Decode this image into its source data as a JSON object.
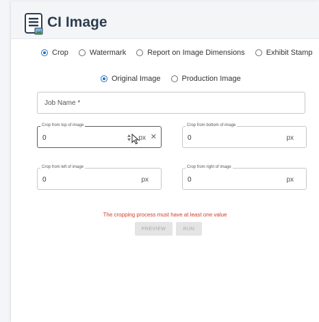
{
  "header": {
    "title": "CI Image",
    "logo_icon": "document-image-icon"
  },
  "mode_options": [
    {
      "label": "Crop",
      "checked": true
    },
    {
      "label": "Watermark",
      "checked": false
    },
    {
      "label": "Report on Image Dimensions",
      "checked": false
    },
    {
      "label": "Exhibit Stamp",
      "checked": false
    }
  ],
  "source_options": [
    {
      "label": "Original Image",
      "checked": true
    },
    {
      "label": "Production Image",
      "checked": false
    }
  ],
  "job_name": {
    "placeholder": "Job Name *",
    "value": ""
  },
  "crop_fields": {
    "top": {
      "label": "Crop from top of image",
      "value": "0",
      "unit": "px",
      "clear": "✕"
    },
    "bottom": {
      "label": "Crop from bottom of image",
      "value": "0",
      "unit": "px"
    },
    "left": {
      "label": "Crop from left of image",
      "value": "0",
      "unit": "px"
    },
    "right": {
      "label": "Crop from right of image",
      "value": "0",
      "unit": "px"
    }
  },
  "error_message": "The cropping process must have at least one value",
  "buttons": {
    "preview": "PREVIEW",
    "run": "RUN"
  },
  "colors": {
    "accent": "#1e6fc5",
    "error": "#d23b2a",
    "title": "#2c3e50",
    "disabled_bg": "#e4e4e4",
    "disabled_text": "#a9a9a9"
  }
}
